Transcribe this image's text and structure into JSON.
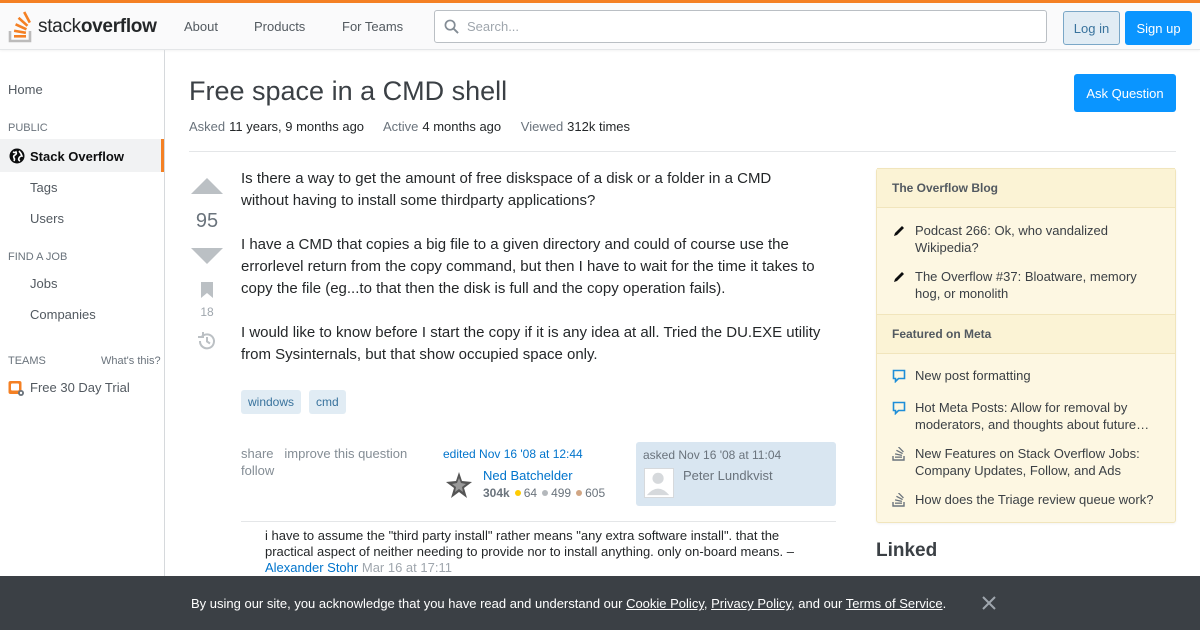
{
  "header": {
    "logo_text_light": "stack",
    "logo_text_bold": "overflow",
    "nav": [
      "About",
      "Products",
      "For Teams"
    ],
    "search_placeholder": "Search...",
    "login_label": "Log in",
    "signup_label": "Sign up",
    "accent_color": "#f48024"
  },
  "sidebar": {
    "home": "Home",
    "public_caption": "PUBLIC",
    "active_item": "Stack Overflow",
    "tags": "Tags",
    "users": "Users",
    "find_job_caption": "FIND A JOB",
    "jobs": "Jobs",
    "companies": "Companies",
    "teams_caption": "TEAMS",
    "whats_this": "What's this?",
    "trial": "Free 30 Day Trial"
  },
  "question": {
    "title": "Free space in a CMD shell",
    "asked_label": "Asked",
    "asked_value": "11 years, 9 months ago",
    "active_label": "Active",
    "active_value": "4 months ago",
    "viewed_label": "Viewed",
    "viewed_value": "312k times",
    "ask_button": "Ask Question",
    "votes": "95",
    "bookmarks": "18",
    "body": [
      "Is there a way to get the amount of free diskspace of a disk or a folder in a CMD without having to install some thirdparty applications?",
      "I have a CMD that copies a big file to a given directory and could of course use the errorlevel return from the copy command, but then I have to wait for the time it takes to copy the file (eg...to that then the disk is full and the copy operation fails).",
      "I would like to know before I start the copy if it is any idea at all. Tried the DU.EXE utility from Sysinternals, but that show occupied space only."
    ],
    "tags": [
      "windows",
      "cmd"
    ],
    "actions": {
      "share": "share",
      "improve": "improve this question",
      "follow": "follow"
    },
    "edited": {
      "label": "edited Nov 16 '08 at 12:44",
      "name": "Ned Batchelder",
      "rep": "304k",
      "gold": "64",
      "silver": "499",
      "bronze": "605"
    },
    "asked_card": {
      "label": "asked Nov 16 '08 at 11:04",
      "name": "Peter Lundkvist"
    },
    "comment": {
      "text": "i have to assume the \"third party install\" rather means \"any extra software install\". that the practical aspect of neither needing to provide nor to install anything. only on-board means. –",
      "user": "Alexander Stohr",
      "time": "Mar 16 at 17:11"
    }
  },
  "right": {
    "blog_title": "The Overflow Blog",
    "blog_items": [
      "Podcast 266: Ok, who vandalized Wikipedia?",
      "The Overflow #37: Bloatware, memory hog, or monolith"
    ],
    "meta_title": "Featured on Meta",
    "meta_items": [
      "New post formatting",
      "Hot Meta Posts: Allow for removal by moderators, and thoughts about future…",
      "New Features on Stack Overflow Jobs: Company Updates, Follow, and Ads",
      "How does the Triage review queue work?"
    ],
    "linked": "Linked"
  },
  "cookie": {
    "prefix": "By using our site, you acknowledge that you have read and understand our ",
    "cookie_policy": "Cookie Policy",
    "sep1": ", ",
    "privacy_policy": "Privacy Policy",
    "sep2": ", and our ",
    "terms": "Terms of Service",
    "suffix": "."
  }
}
